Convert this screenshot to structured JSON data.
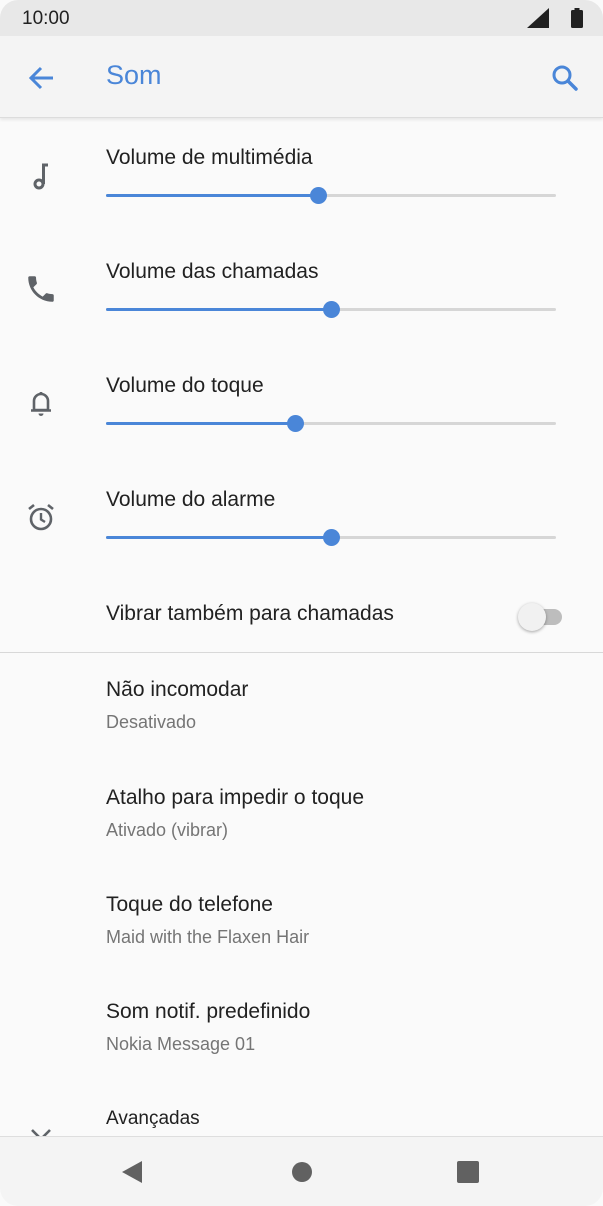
{
  "status_bar": {
    "time": "10:00",
    "icons": [
      "signal-icon",
      "battery-icon"
    ]
  },
  "app_bar": {
    "title": "Som",
    "back_icon": "arrow-back-icon",
    "search_icon": "search-icon"
  },
  "volume_sliders": [
    {
      "label": "Volume de multimédia",
      "icon": "music-note-icon",
      "level": 0.47
    },
    {
      "label": "Volume das chamadas",
      "icon": "phone-icon",
      "level": 0.5
    },
    {
      "label": "Volume do toque",
      "icon": "bell-icon",
      "level": 0.42
    },
    {
      "label": "Volume do alarme",
      "icon": "alarm-clock-icon",
      "level": 0.5
    }
  ],
  "vibrate": {
    "label": "Vibrar também para chamadas",
    "enabled": false
  },
  "settings_items": [
    {
      "title": "Não incomodar",
      "subtitle": "Desativado"
    },
    {
      "title": "Atalho para impedir o toque",
      "subtitle": "Ativado (vibrar)"
    },
    {
      "title": "Toque do telefone",
      "subtitle": "Maid with the Flaxen Hair"
    },
    {
      "title": "Som notif. predefinido",
      "subtitle": "Nokia Message 01"
    }
  ],
  "advanced": {
    "label": "Avançadas",
    "icon": "chevron-down-icon"
  },
  "nav_bar": {
    "buttons": [
      "back-triangle-icon",
      "home-circle-icon",
      "recents-square-icon"
    ]
  },
  "colors": {
    "accent": "#4a86d8",
    "icon_gray": "#5f6368",
    "track_gray": "#d6d6d6"
  }
}
